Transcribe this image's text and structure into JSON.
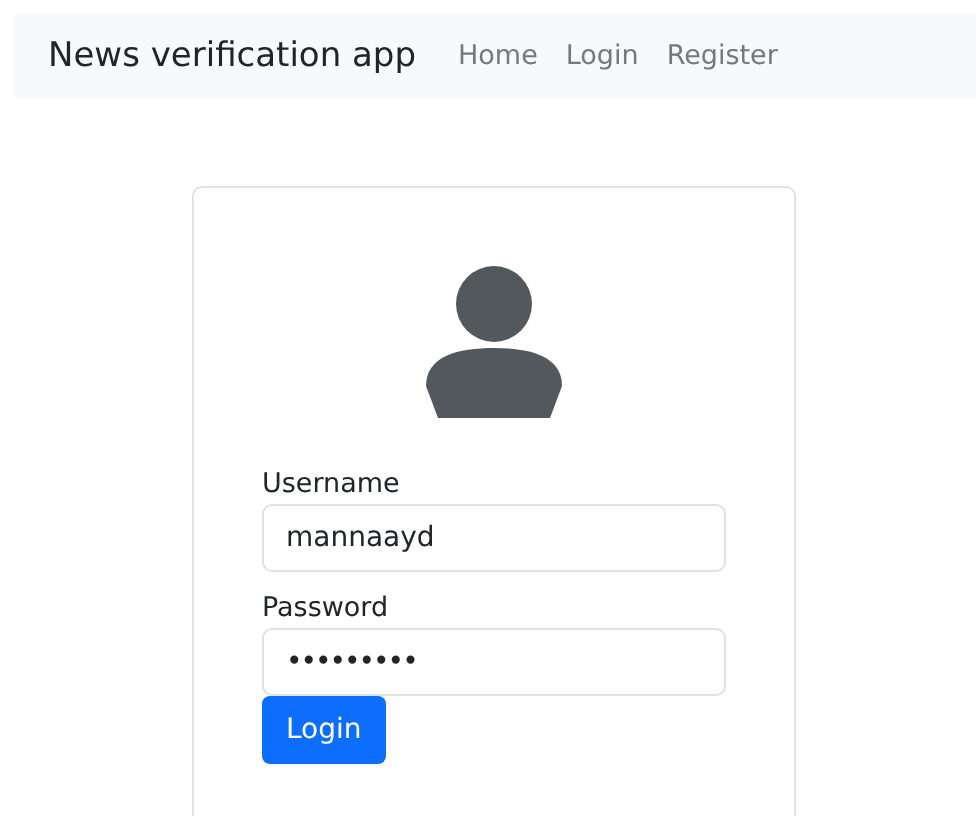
{
  "navbar": {
    "brand": "News verification app",
    "links": [
      {
        "label": "Home"
      },
      {
        "label": "Login"
      },
      {
        "label": "Register"
      }
    ]
  },
  "login_form": {
    "fields": [
      {
        "kind": "text",
        "label": "Username",
        "value": "mannaayd"
      },
      {
        "kind": "password",
        "label": "Password",
        "value": "•••••••••"
      }
    ],
    "submit": "Login"
  }
}
